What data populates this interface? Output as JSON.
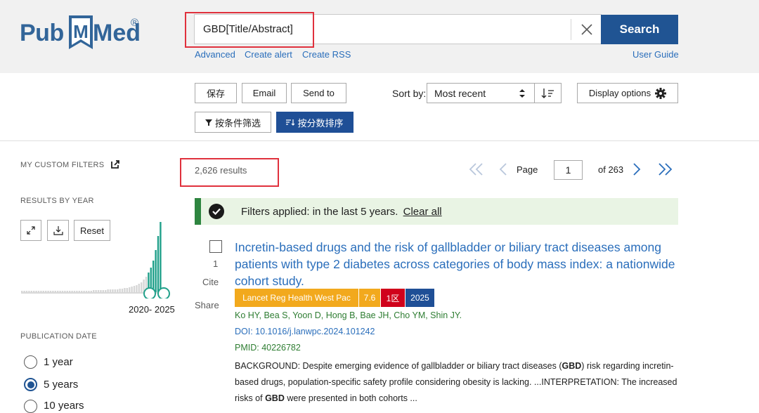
{
  "header": {
    "logo_pub": "Pub",
    "logo_med": "Med",
    "logo_reg": "®",
    "search_value": "GBD[Title/Abstract]",
    "search_button": "Search",
    "links": {
      "advanced": "Advanced",
      "create_alert": "Create alert",
      "create_rss": "Create RSS",
      "user_guide": "User Guide"
    }
  },
  "toolbar": {
    "save": "保存",
    "email": "Email",
    "send_to": "Send to",
    "sort_label": "Sort by:",
    "sort_value": "Most recent",
    "display_options": "Display options",
    "filter_button": "按条件筛选",
    "score_button": "按分数排序"
  },
  "sidebar": {
    "custom_filters": "MY CUSTOM FILTERS",
    "results_by_year": "RESULTS BY YEAR",
    "reset": "Reset",
    "year_range": "2020- 2025",
    "publication_date": "PUBLICATION DATE",
    "date_options": [
      {
        "label": "1 year",
        "selected": false
      },
      {
        "label": "5 years",
        "selected": true
      },
      {
        "label": "10 years",
        "selected": false
      }
    ],
    "timeline_bars": [
      2,
      2,
      2,
      2,
      2,
      2,
      2,
      2,
      2,
      2,
      2,
      2,
      2,
      2,
      2,
      2,
      2,
      2,
      2,
      2,
      2,
      2,
      2,
      2,
      2,
      2,
      2,
      2,
      2,
      2,
      3,
      3,
      3,
      3,
      3,
      3,
      4,
      4,
      4,
      4,
      4,
      5,
      5,
      6,
      6,
      7,
      8,
      9,
      10,
      12,
      14,
      18,
      22,
      28,
      35,
      45,
      60,
      80,
      100
    ]
  },
  "results": {
    "count": "2,626 results",
    "page_label": "Page",
    "page_value": "1",
    "page_total": "of 263"
  },
  "filters_bar": {
    "text": "Filters applied: in the last 5 years.",
    "clear_all": "Clear all"
  },
  "article": {
    "index": "1",
    "cite": "Cite",
    "share": "Share",
    "title": "Incretin-based drugs and the risk of gallbladder or biliary tract diseases among patients with type 2 diabetes across categories of body mass index: a nationwide cohort study.",
    "badges": [
      {
        "text": "Lancet Reg Health West Pac",
        "color": "#f2a91d"
      },
      {
        "text": "7.6",
        "color": "#f2a91d"
      },
      {
        "text": "1区",
        "color": "#d0021b"
      },
      {
        "text": "2025",
        "color": "#1f4f96"
      }
    ],
    "authors": "Ko HY, Bea S, Yoon D, Hong B, Bae JH, Cho YM, Shin JY.",
    "doi": "DOI: 10.1016/j.lanwpc.2024.101242",
    "pmid": "PMID: 40226782",
    "snippet_1": "BACKGROUND: Despite emerging evidence of gallbladder or biliary tract diseases (",
    "snippet_bold_1": "GBD",
    "snippet_2": ") risk regarding incretin-based drugs, population-specific safety profile considering obesity is lacking. ...INTERPRETATION: The increased risks of ",
    "snippet_bold_2": "GBD",
    "snippet_3": " were presented in both cohorts ..."
  },
  "colors": {
    "brand": "#205493",
    "link": "#2a6ebb",
    "highlight": "#e0313d",
    "filters_green": "#2e8540",
    "timeline_teal": "#20a08a"
  }
}
